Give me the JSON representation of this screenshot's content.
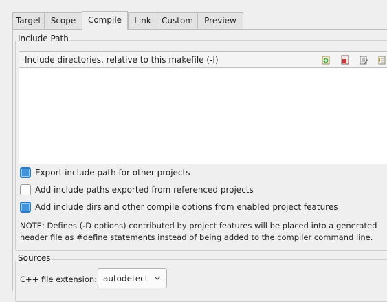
{
  "tabs": [
    {
      "label": "Target"
    },
    {
      "label": "Scope"
    },
    {
      "label": "Compile",
      "active": true
    },
    {
      "label": "Link"
    },
    {
      "label": "Custom"
    },
    {
      "label": "Preview"
    }
  ],
  "include_path": {
    "group_title": "Include Path",
    "list_header": "Include directories, relative to this makefile (-I)",
    "toolbar_icons": [
      "add-directory-icon",
      "remove-directory-icon",
      "edit-directory-icon",
      "move-directory-icon"
    ],
    "checkboxes": [
      {
        "label": "Export include path for other projects",
        "checked": true
      },
      {
        "label": "Add include paths exported from referenced projects",
        "checked": false
      },
      {
        "label": "Add include dirs and other compile options from enabled project features",
        "checked": true
      }
    ],
    "note_line1": "NOTE: Defines (-D options) contributed by project features will be placed into a generated",
    "note_line2": "header file as #define statements instead of being added to the compiler command line."
  },
  "sources": {
    "group_title": "Sources",
    "cpp_ext_label": "C++ file extension:",
    "cpp_ext_value": "autodetect"
  },
  "colors": {
    "checkbox_on": "#3f94db",
    "background": "#efefef"
  }
}
